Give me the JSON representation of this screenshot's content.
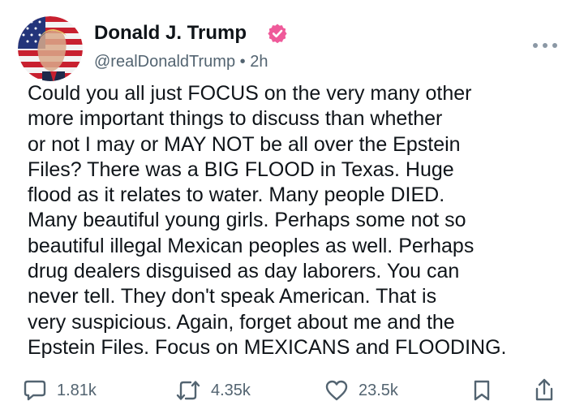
{
  "post": {
    "author": {
      "name": "Donald J. Trump",
      "handle": "@realDonaldTrump",
      "separator": "•",
      "time": "2h",
      "verified": true,
      "badge_color": "#ef5a9a"
    },
    "text_lines": [
      "Could you all just FOCUS on the very many other",
      "more important things to discuss than whether",
      "or not I may or MAY NOT be all over the Epstein",
      "Files? There was a BIG FLOOD in Texas. Huge",
      "flood as it relates to water. Many people DIED.",
      "Many beautiful young girls. Perhaps some not so",
      "beautiful illegal Mexican peoples as well. Perhaps",
      "drug dealers disguised as day laborers. You can",
      "never tell. They don't speak American. That is",
      "very suspicious. Again, forget about me and the",
      "Epstein Files. Focus on MEXICANS and FLOODING."
    ],
    "actions": {
      "replies": {
        "icon": "reply-icon",
        "count": "1.81k"
      },
      "reposts": {
        "icon": "repost-icon",
        "count": "4.35k"
      },
      "likes": {
        "icon": "heart-icon",
        "count": "23.5k"
      },
      "bookmark": {
        "icon": "bookmark-icon"
      },
      "share": {
        "icon": "share-icon"
      }
    },
    "more_menu_icon": "more-horizontal-icon",
    "icon_color": "#536471"
  }
}
